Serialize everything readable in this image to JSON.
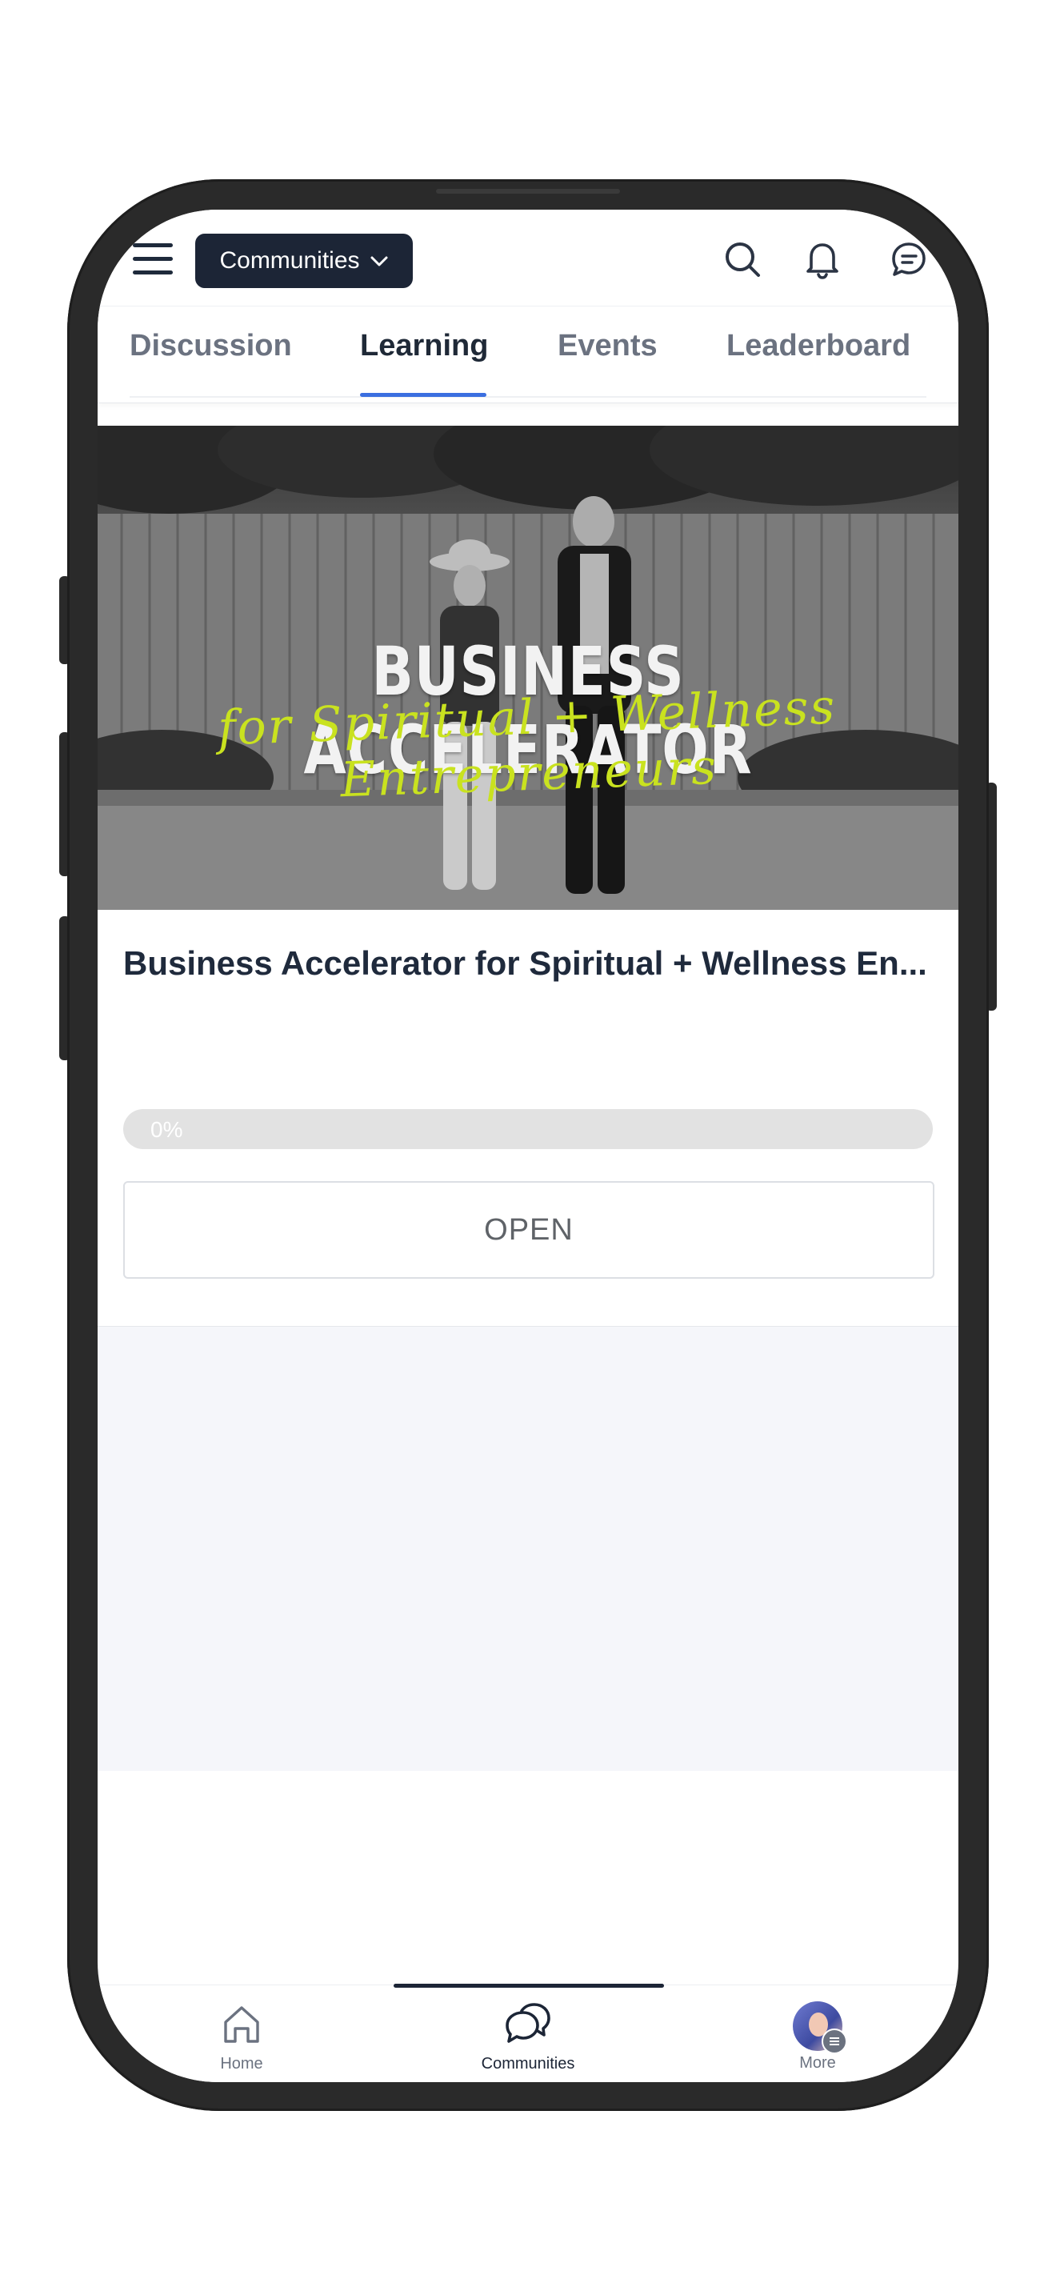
{
  "header": {
    "community_selector_label": "Communities"
  },
  "tabs": [
    {
      "label": "Discussion",
      "active": false
    },
    {
      "label": "Learning",
      "active": true
    },
    {
      "label": "Events",
      "active": false
    },
    {
      "label": "Leaderboard",
      "active": false
    }
  ],
  "course": {
    "cover_title": "BUSINESS ACCELERATOR",
    "cover_subtitle": "for Spiritual + Wellness Entrepreneurs",
    "title": "Business Accelerator for Spiritual + Wellness En...",
    "progress_label": "0%",
    "progress_fraction": 0,
    "open_label": "OPEN"
  },
  "bottom_nav": {
    "items": [
      {
        "label": "Home",
        "icon": "home-icon",
        "active": false
      },
      {
        "label": "Communities",
        "icon": "communities-icon",
        "active": true
      },
      {
        "label": "More",
        "icon": "avatar",
        "active": false
      }
    ]
  },
  "colors": {
    "accent": "#3b6fe0",
    "dark": "#1c2536",
    "cover_subtitle": "#c9e21f",
    "empty_area": "#f5f6fa"
  }
}
